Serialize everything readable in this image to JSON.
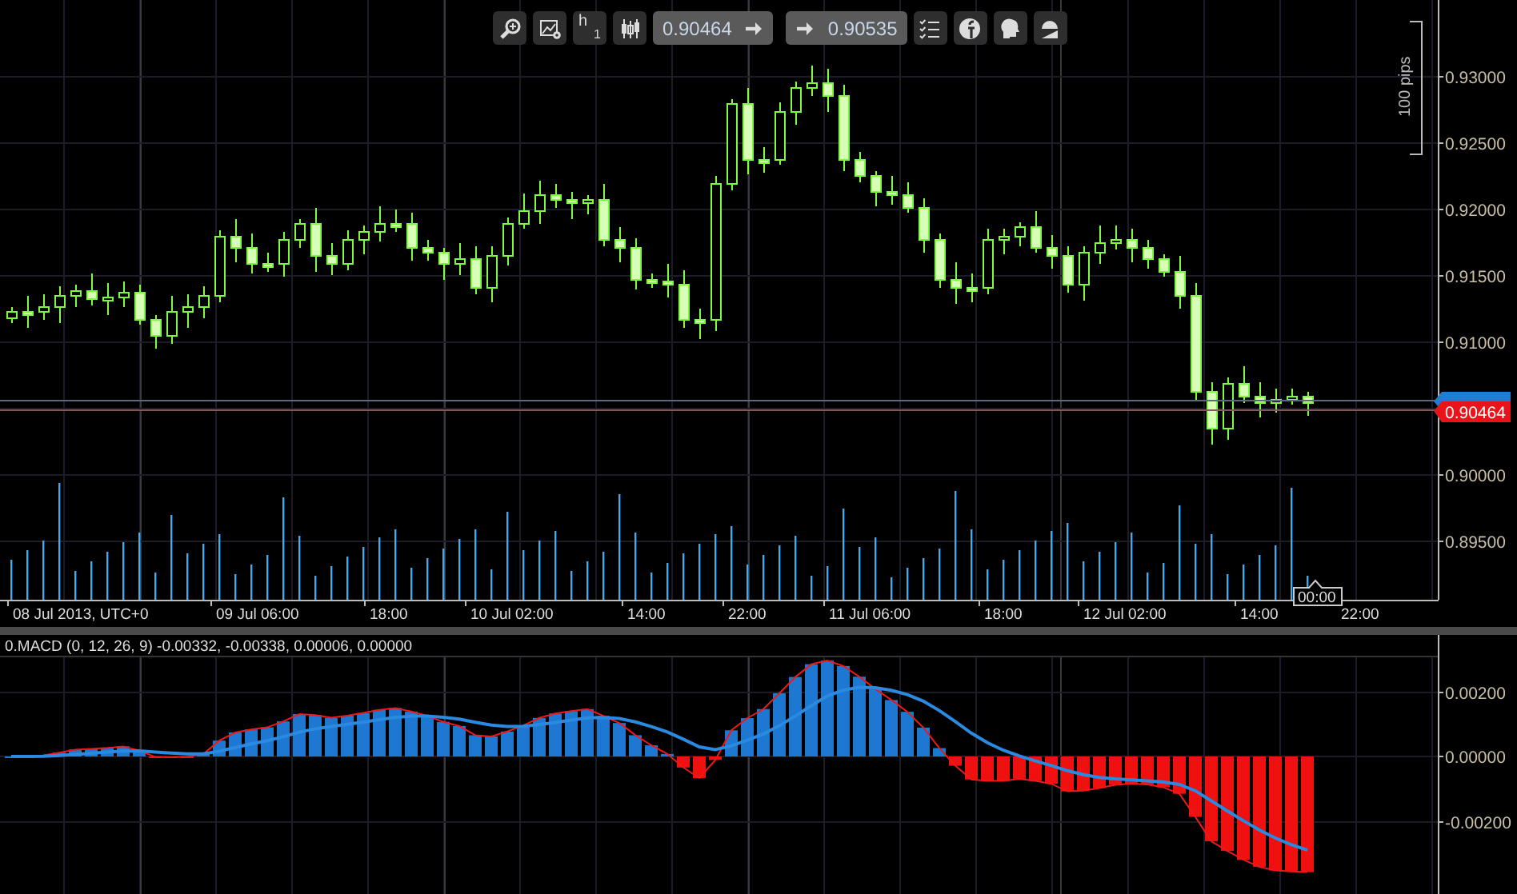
{
  "toolbar": {
    "timeframe": {
      "unit": "h",
      "count": "1"
    },
    "sell_price": "0.90464",
    "buy_price": "0.90535"
  },
  "price_axis": {
    "ticks": [
      "0.93000",
      "0.92500",
      "0.92000",
      "0.91500",
      "0.91000",
      "0.90000",
      "0.89500"
    ],
    "current_price": "0.90464",
    "range_marker": "100 pips"
  },
  "time_axis": {
    "labels": [
      "08 Jul 2013, UTC+0",
      "09 Jul 06:00",
      "18:00",
      "10 Jul 02:00",
      "14:00",
      "22:00",
      "11 Jul 06:00",
      "18:00",
      "12 Jul 02:00",
      "14:00",
      "22:00"
    ],
    "cursor_label": "00:00"
  },
  "macd": {
    "legend": "0.MACD (0, 12, 26, 9) -0.00332, -0.00338, 0.00006, 0.00000",
    "axis_ticks": [
      "0.00200",
      "0.00000",
      "-0.00200"
    ]
  }
}
